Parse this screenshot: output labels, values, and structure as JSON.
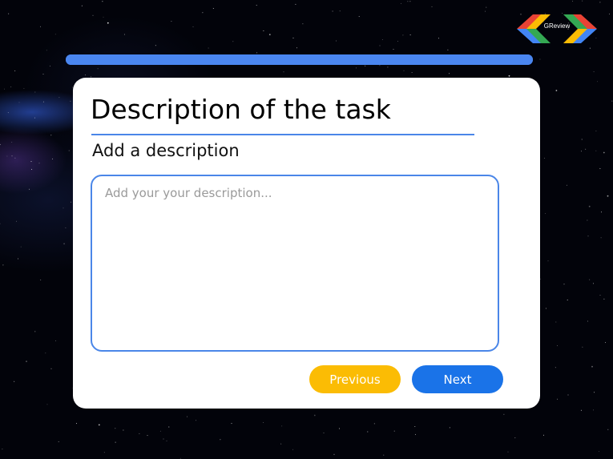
{
  "logo": {
    "text": "GReview",
    "colors": [
      "#ea4335",
      "#fbbc04",
      "#34a853",
      "#4285f4"
    ]
  },
  "progress": {
    "value": 1.0,
    "color": "#4a86f0"
  },
  "card": {
    "title": "Description of the task",
    "subtitle": "Add a description",
    "description": {
      "value": "",
      "placeholder": "Add your your description..."
    }
  },
  "buttons": {
    "previous": "Previous",
    "next": "Next"
  },
  "colors": {
    "accent": "#4a86e8",
    "previous_button": "#fbbc04",
    "next_button": "#1a73e8",
    "background": "#000000",
    "card": "#ffffff"
  }
}
